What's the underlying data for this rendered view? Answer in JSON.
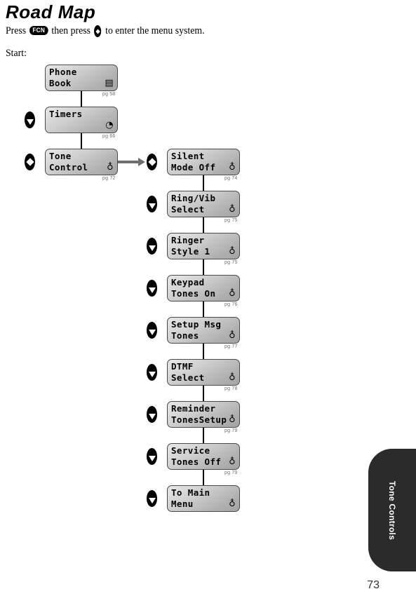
{
  "page": {
    "title": "Road Map",
    "intro_prefix": "Press",
    "intro_key": "FCN",
    "intro_middle": "then press",
    "intro_suffix": "to enter the menu system.",
    "start_label": "Start:",
    "folio": "73"
  },
  "side_tab": {
    "label": "Tone Controls",
    "color": "#2b2b2b"
  },
  "colors": {
    "node_border": "#4a4a4a",
    "node_light": "#e8e8e8",
    "node_dark": "#a4a4a4",
    "connector": "#000000",
    "arrow": "#6e6e6e",
    "pgref": "#6f6f6f"
  },
  "main_column": {
    "nodes": [
      {
        "line1": "Phone",
        "line2": "Book",
        "glyph": "▤",
        "icon_name": "book-icon",
        "pgref": "pg 58"
      },
      {
        "line1": "Timers",
        "line2": "",
        "glyph": "◔",
        "icon_name": "clock-icon",
        "pgref": "pg 66"
      },
      {
        "line1": "Tone",
        "line2": "Control",
        "glyph": "♁",
        "icon_name": "bell-icon",
        "pgref": "pg 72"
      }
    ],
    "keys": [
      {
        "index": 1,
        "type": "down",
        "name": "nav-key-down"
      },
      {
        "index": 2,
        "type": "diamond",
        "name": "nav-key-select"
      }
    ]
  },
  "tone_column": {
    "nodes": [
      {
        "line1": "Silent",
        "line2": "Mode Off",
        "glyph": "♁",
        "icon_name": "bell-icon",
        "pgref": "pg 74",
        "key": "diamond"
      },
      {
        "line1": "Ring/Vib",
        "line2": "Select",
        "glyph": "♁",
        "icon_name": "bell-icon",
        "pgref": "pg 75",
        "key": "down"
      },
      {
        "line1": "Ringer",
        "line2": "Style 1",
        "glyph": "♁",
        "icon_name": "bell-icon",
        "pgref": "pg 75",
        "key": "down"
      },
      {
        "line1": "Keypad",
        "line2": "Tones On",
        "glyph": "♁",
        "icon_name": "bell-icon",
        "pgref": "pg 76",
        "key": "down"
      },
      {
        "line1": "Setup Msg",
        "line2": "Tones",
        "glyph": "♁",
        "icon_name": "bell-icon",
        "pgref": "pg 77",
        "key": "down"
      },
      {
        "line1": "DTMF",
        "line2": "Select",
        "glyph": "♁",
        "icon_name": "bell-icon",
        "pgref": "pg 78",
        "key": "down"
      },
      {
        "line1": "Reminder",
        "line2": "TonesSetup",
        "glyph": "♁",
        "icon_name": "bell-icon",
        "pgref": "pg 79",
        "key": "down"
      },
      {
        "line1": "Service",
        "line2": "Tones Off",
        "glyph": "♁",
        "icon_name": "bell-icon",
        "pgref": "pg 79",
        "key": "down"
      },
      {
        "line1": "To Main",
        "line2": "Menu",
        "glyph": "♁",
        "icon_name": "bell-icon",
        "pgref": "",
        "key": "down"
      }
    ]
  }
}
